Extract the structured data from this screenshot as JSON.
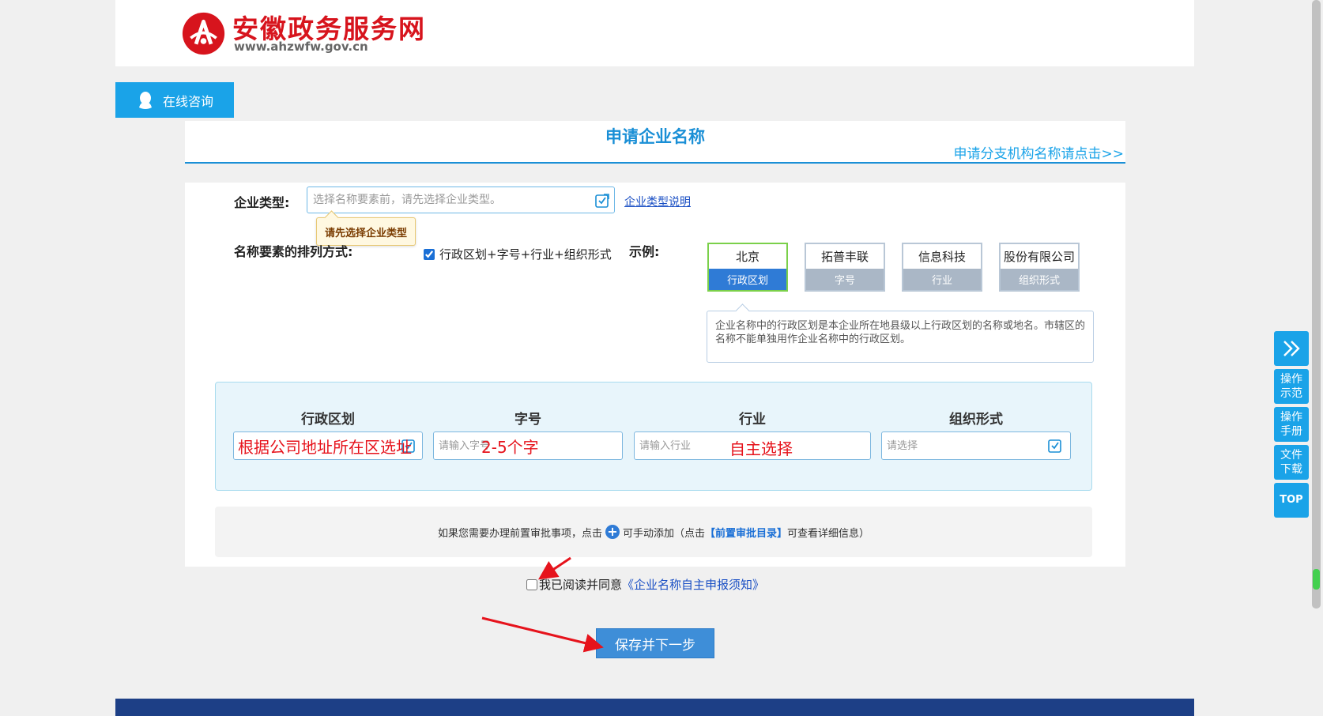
{
  "header": {
    "site_name": "安徽政务服务网",
    "url": "www.ahzwfw.gov.cn"
  },
  "consult_label": "在线咨询",
  "panel": {
    "title": "申请企业名称",
    "branch_link": "申请分支机构名称请点击>>"
  },
  "company_type": {
    "label": "企业类型:",
    "placeholder": "选择名称要素前，请先选择企业类型。",
    "help_link": "企业类型说明",
    "tooltip": "请先选择企业类型"
  },
  "order": {
    "label": "名称要素的排列方式:",
    "option": "行政区划+字号+行业+组织形式",
    "checked": true
  },
  "example": {
    "label": "示例:",
    "boxes": [
      {
        "value": "北京",
        "caption": "行政区划",
        "active": true
      },
      {
        "value": "拓普丰联",
        "caption": "字号",
        "active": false
      },
      {
        "value": "信息科技",
        "caption": "行业",
        "active": false
      },
      {
        "value": "股份有限公司",
        "caption": "组织形式",
        "active": false
      }
    ],
    "description": "企业名称中的行政区划是本企业所在地县级以上行政区划的名称或地名。市辖区的名称不能单独用作企业名称中的行政区划。"
  },
  "name_fields": [
    {
      "header": "行政区划",
      "placeholder": "",
      "annotation": "根据公司地址所在区选址"
    },
    {
      "header": "字号",
      "placeholder": "请输入字号",
      "annotation": "2-5个字"
    },
    {
      "header": "行业",
      "placeholder": "请输入行业",
      "annotation": "自主选择"
    },
    {
      "header": "组织形式",
      "placeholder": "请选择",
      "annotation": ""
    }
  ],
  "approval": {
    "text_before": "如果您需要办理前置审批事项，点击",
    "text_middle": "可手动添加（点击",
    "catalog_link": "【前置审批目录】",
    "text_after": "可查看详细信息）"
  },
  "agree": {
    "text": "我已阅读并同意",
    "link": "《企业名称自主申报须知》",
    "checked": false
  },
  "save_button": "保存并下一步",
  "side_buttons": [
    "操作示范",
    "操作手册",
    "文件下载",
    "TOP"
  ],
  "colors": {
    "brand_red": "#d7141d",
    "accent_blue": "#1aa3e8",
    "annotation_red": "#e6131c",
    "footer": "#1d3f86"
  }
}
